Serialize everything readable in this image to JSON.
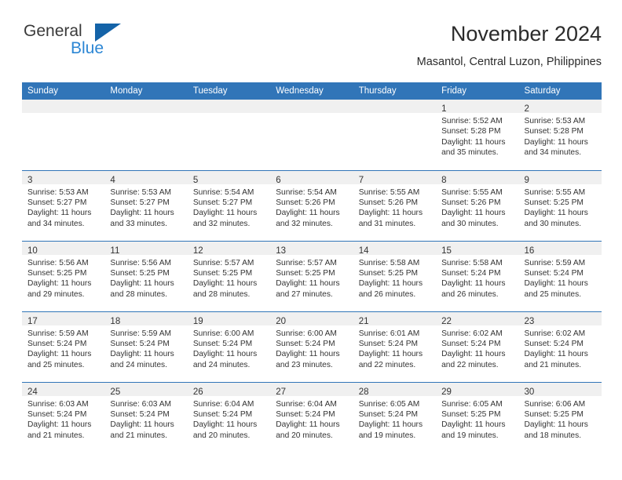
{
  "brand": {
    "name_top": "General",
    "name_bottom": "Blue",
    "triangle_color": "#1463a8",
    "blue_text_color": "#2b86d4"
  },
  "header": {
    "title": "November 2024",
    "subtitle": "Masantol, Central Luzon, Philippines"
  },
  "theme": {
    "header_blue": "#3175b8",
    "daynum_band": "#f0f0f0",
    "text": "#333333"
  },
  "weekday_headers": [
    "Sunday",
    "Monday",
    "Tuesday",
    "Wednesday",
    "Thursday",
    "Friday",
    "Saturday"
  ],
  "weeks": [
    [
      {
        "day": "",
        "empty": true,
        "line1": "",
        "line2": "",
        "line3": "",
        "line4": ""
      },
      {
        "day": "",
        "empty": true,
        "line1": "",
        "line2": "",
        "line3": "",
        "line4": ""
      },
      {
        "day": "",
        "empty": true,
        "line1": "",
        "line2": "",
        "line3": "",
        "line4": ""
      },
      {
        "day": "",
        "empty": true,
        "line1": "",
        "line2": "",
        "line3": "",
        "line4": ""
      },
      {
        "day": "",
        "empty": true,
        "line1": "",
        "line2": "",
        "line3": "",
        "line4": ""
      },
      {
        "day": "1",
        "empty": false,
        "line1": "Sunrise: 5:52 AM",
        "line2": "Sunset: 5:28 PM",
        "line3": "Daylight: 11 hours",
        "line4": "and 35 minutes."
      },
      {
        "day": "2",
        "empty": false,
        "line1": "Sunrise: 5:53 AM",
        "line2": "Sunset: 5:28 PM",
        "line3": "Daylight: 11 hours",
        "line4": "and 34 minutes."
      }
    ],
    [
      {
        "day": "3",
        "empty": false,
        "line1": "Sunrise: 5:53 AM",
        "line2": "Sunset: 5:27 PM",
        "line3": "Daylight: 11 hours",
        "line4": "and 34 minutes."
      },
      {
        "day": "4",
        "empty": false,
        "line1": "Sunrise: 5:53 AM",
        "line2": "Sunset: 5:27 PM",
        "line3": "Daylight: 11 hours",
        "line4": "and 33 minutes."
      },
      {
        "day": "5",
        "empty": false,
        "line1": "Sunrise: 5:54 AM",
        "line2": "Sunset: 5:27 PM",
        "line3": "Daylight: 11 hours",
        "line4": "and 32 minutes."
      },
      {
        "day": "6",
        "empty": false,
        "line1": "Sunrise: 5:54 AM",
        "line2": "Sunset: 5:26 PM",
        "line3": "Daylight: 11 hours",
        "line4": "and 32 minutes."
      },
      {
        "day": "7",
        "empty": false,
        "line1": "Sunrise: 5:55 AM",
        "line2": "Sunset: 5:26 PM",
        "line3": "Daylight: 11 hours",
        "line4": "and 31 minutes."
      },
      {
        "day": "8",
        "empty": false,
        "line1": "Sunrise: 5:55 AM",
        "line2": "Sunset: 5:26 PM",
        "line3": "Daylight: 11 hours",
        "line4": "and 30 minutes."
      },
      {
        "day": "9",
        "empty": false,
        "line1": "Sunrise: 5:55 AM",
        "line2": "Sunset: 5:25 PM",
        "line3": "Daylight: 11 hours",
        "line4": "and 30 minutes."
      }
    ],
    [
      {
        "day": "10",
        "empty": false,
        "line1": "Sunrise: 5:56 AM",
        "line2": "Sunset: 5:25 PM",
        "line3": "Daylight: 11 hours",
        "line4": "and 29 minutes."
      },
      {
        "day": "11",
        "empty": false,
        "line1": "Sunrise: 5:56 AM",
        "line2": "Sunset: 5:25 PM",
        "line3": "Daylight: 11 hours",
        "line4": "and 28 minutes."
      },
      {
        "day": "12",
        "empty": false,
        "line1": "Sunrise: 5:57 AM",
        "line2": "Sunset: 5:25 PM",
        "line3": "Daylight: 11 hours",
        "line4": "and 28 minutes."
      },
      {
        "day": "13",
        "empty": false,
        "line1": "Sunrise: 5:57 AM",
        "line2": "Sunset: 5:25 PM",
        "line3": "Daylight: 11 hours",
        "line4": "and 27 minutes."
      },
      {
        "day": "14",
        "empty": false,
        "line1": "Sunrise: 5:58 AM",
        "line2": "Sunset: 5:25 PM",
        "line3": "Daylight: 11 hours",
        "line4": "and 26 minutes."
      },
      {
        "day": "15",
        "empty": false,
        "line1": "Sunrise: 5:58 AM",
        "line2": "Sunset: 5:24 PM",
        "line3": "Daylight: 11 hours",
        "line4": "and 26 minutes."
      },
      {
        "day": "16",
        "empty": false,
        "line1": "Sunrise: 5:59 AM",
        "line2": "Sunset: 5:24 PM",
        "line3": "Daylight: 11 hours",
        "line4": "and 25 minutes."
      }
    ],
    [
      {
        "day": "17",
        "empty": false,
        "line1": "Sunrise: 5:59 AM",
        "line2": "Sunset: 5:24 PM",
        "line3": "Daylight: 11 hours",
        "line4": "and 25 minutes."
      },
      {
        "day": "18",
        "empty": false,
        "line1": "Sunrise: 5:59 AM",
        "line2": "Sunset: 5:24 PM",
        "line3": "Daylight: 11 hours",
        "line4": "and 24 minutes."
      },
      {
        "day": "19",
        "empty": false,
        "line1": "Sunrise: 6:00 AM",
        "line2": "Sunset: 5:24 PM",
        "line3": "Daylight: 11 hours",
        "line4": "and 24 minutes."
      },
      {
        "day": "20",
        "empty": false,
        "line1": "Sunrise: 6:00 AM",
        "line2": "Sunset: 5:24 PM",
        "line3": "Daylight: 11 hours",
        "line4": "and 23 minutes."
      },
      {
        "day": "21",
        "empty": false,
        "line1": "Sunrise: 6:01 AM",
        "line2": "Sunset: 5:24 PM",
        "line3": "Daylight: 11 hours",
        "line4": "and 22 minutes."
      },
      {
        "day": "22",
        "empty": false,
        "line1": "Sunrise: 6:02 AM",
        "line2": "Sunset: 5:24 PM",
        "line3": "Daylight: 11 hours",
        "line4": "and 22 minutes."
      },
      {
        "day": "23",
        "empty": false,
        "line1": "Sunrise: 6:02 AM",
        "line2": "Sunset: 5:24 PM",
        "line3": "Daylight: 11 hours",
        "line4": "and 21 minutes."
      }
    ],
    [
      {
        "day": "24",
        "empty": false,
        "line1": "Sunrise: 6:03 AM",
        "line2": "Sunset: 5:24 PM",
        "line3": "Daylight: 11 hours",
        "line4": "and 21 minutes."
      },
      {
        "day": "25",
        "empty": false,
        "line1": "Sunrise: 6:03 AM",
        "line2": "Sunset: 5:24 PM",
        "line3": "Daylight: 11 hours",
        "line4": "and 21 minutes."
      },
      {
        "day": "26",
        "empty": false,
        "line1": "Sunrise: 6:04 AM",
        "line2": "Sunset: 5:24 PM",
        "line3": "Daylight: 11 hours",
        "line4": "and 20 minutes."
      },
      {
        "day": "27",
        "empty": false,
        "line1": "Sunrise: 6:04 AM",
        "line2": "Sunset: 5:24 PM",
        "line3": "Daylight: 11 hours",
        "line4": "and 20 minutes."
      },
      {
        "day": "28",
        "empty": false,
        "line1": "Sunrise: 6:05 AM",
        "line2": "Sunset: 5:24 PM",
        "line3": "Daylight: 11 hours",
        "line4": "and 19 minutes."
      },
      {
        "day": "29",
        "empty": false,
        "line1": "Sunrise: 6:05 AM",
        "line2": "Sunset: 5:25 PM",
        "line3": "Daylight: 11 hours",
        "line4": "and 19 minutes."
      },
      {
        "day": "30",
        "empty": false,
        "line1": "Sunrise: 6:06 AM",
        "line2": "Sunset: 5:25 PM",
        "line3": "Daylight: 11 hours",
        "line4": "and 18 minutes."
      }
    ]
  ]
}
